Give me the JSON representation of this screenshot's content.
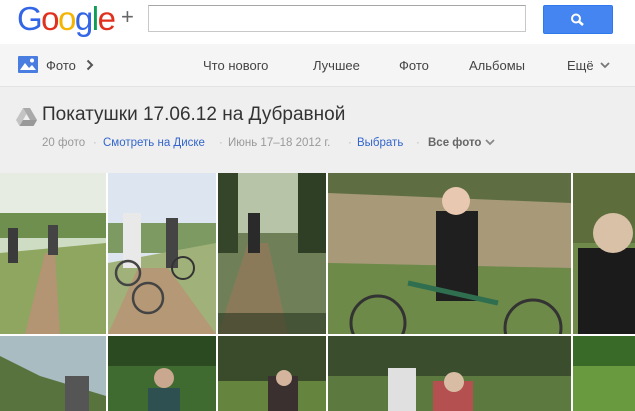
{
  "app": {
    "logo_letters": [
      {
        "char": "G",
        "color": "#3366e6"
      },
      {
        "char": "o",
        "color": "#e0301e"
      },
      {
        "char": "o",
        "color": "#f4b400"
      },
      {
        "char": "g",
        "color": "#3366e6"
      },
      {
        "char": "l",
        "color": "#0f9d58"
      },
      {
        "char": "e",
        "color": "#e0301e"
      }
    ],
    "logo_plus": "+",
    "search_value": "",
    "search_icon": "search-icon"
  },
  "nav": {
    "section_label": "Фото",
    "tabs": [
      {
        "label": "Что нового"
      },
      {
        "label": "Лучшее"
      },
      {
        "label": "Фото"
      },
      {
        "label": "Альбомы"
      },
      {
        "label": "Ещё"
      }
    ]
  },
  "album": {
    "title": "Покатушки 17.06.12 на Дубравной",
    "count": "20 фото",
    "view_on_drive": "Смотреть на Диске",
    "dates": "Июнь 17–18 2012 г.",
    "select": "Выбрать",
    "all_photos": "Все фото",
    "separator": "·"
  },
  "photos": [
    {
      "name": "photo-1",
      "colors": [
        "#c8d8c0",
        "#8fa670",
        "#b79a7a"
      ]
    },
    {
      "name": "photo-2",
      "colors": [
        "#d8e2f0",
        "#97b080",
        "#a88a66"
      ]
    },
    {
      "name": "photo-3",
      "colors": [
        "#8c9b7c",
        "#5f7a45",
        "#3c4a2e"
      ]
    },
    {
      "name": "photo-4",
      "colors": [
        "#9aa08a",
        "#7a8a5a",
        "#5a6e38"
      ]
    },
    {
      "name": "photo-5",
      "colors": [
        "#c9d8e8",
        "#5b6b3a",
        "#2a2a2a"
      ]
    },
    {
      "name": "photo-6",
      "colors": [
        "#b0c4c8",
        "#6f8a52",
        "#3a4b28"
      ]
    },
    {
      "name": "photo-7",
      "colors": [
        "#dfe7d8",
        "#4f7a3a",
        "#2b4a24"
      ]
    },
    {
      "name": "photo-8",
      "colors": [
        "#c0d8e0",
        "#5a7a40",
        "#3a3a30"
      ]
    },
    {
      "name": "photo-9",
      "colors": [
        "#d0dcc8",
        "#50703a",
        "#405030"
      ]
    },
    {
      "name": "photo-10",
      "colors": [
        "#b8d0b0",
        "#6a9a40",
        "#3a6a28"
      ]
    }
  ]
}
